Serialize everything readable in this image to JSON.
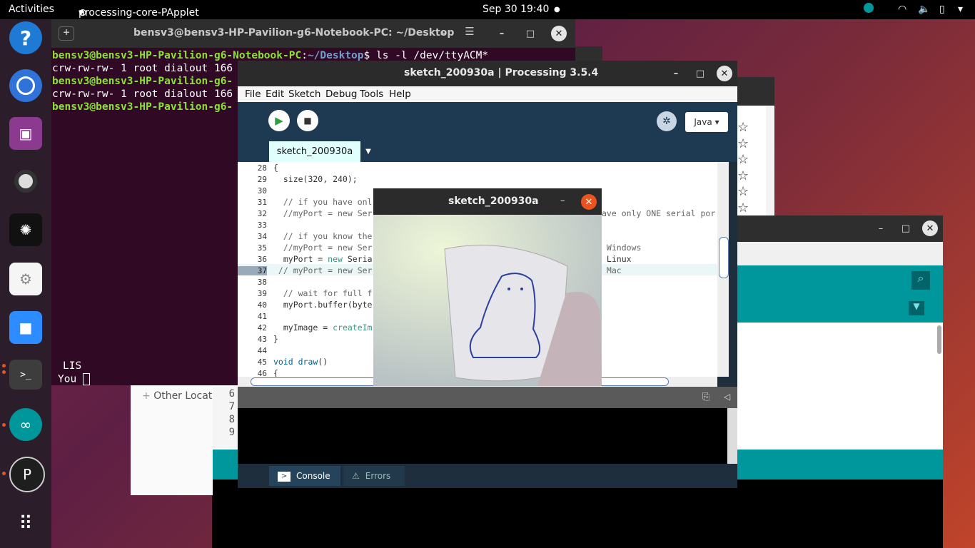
{
  "topbar": {
    "activities": "Activities",
    "app_name": "processing-core-PApplet",
    "clock": "Sep 30  19:40"
  },
  "dock": {
    "items": [
      "help",
      "chromium",
      "video-editor",
      "webcam",
      "iota-wallet",
      "settings",
      "zoom",
      "terminal",
      "arduino",
      "processing",
      "app-grid"
    ]
  },
  "terminal": {
    "title": "bensv3@bensv3-HP-Pavilion-g6-Notebook-PC: ~/Desktop",
    "prompt_user": "bensv3@bensv3-HP-Pavilion-g6-Notebook-PC",
    "prompt_path": "~/Desktop",
    "command": "$ ls -l /dev/ttyACM*",
    "line2": "crw-rw-rw- 1 root dialout 166",
    "line3_user": "bensv3@bensv3-HP-Pavilion-g6-",
    "line4": "crw-rw-rw- 1 root dialout 166",
    "line5_user": "bensv3@bensv3-HP-Pavilion-g6-",
    "bottom_line1": "LIS",
    "bottom_line2": "You"
  },
  "files": {
    "other_locations": "Other Locat"
  },
  "processing": {
    "title": "sketch_200930a | Processing 3.5.4",
    "menu": [
      "File",
      "Edit",
      "Sketch",
      "Debug",
      "Tools",
      "Help"
    ],
    "mode": "Java",
    "tab": "sketch_200930a",
    "line_numbers": [
      "28",
      "29",
      "30",
      "31",
      "32",
      "33",
      "34",
      "35",
      "36",
      "37",
      "38",
      "39",
      "40",
      "41",
      "42",
      "43",
      "44",
      "45",
      "46"
    ],
    "code": {
      "l28": "{",
      "l29": "  size(320, 240);",
      "l31": "  // if you have onl",
      "l32": "  //myPort = new Ser",
      "l32_tail": "ave only ONE serial por",
      "l34": "  // if you know the",
      "l35": "  //myPort = new Ser",
      "l35_tail": " Windows",
      "l36": "  myPort = ",
      "l36_new": "new",
      "l36_b": " Seria",
      "l36_tail": " Linux",
      "l37": " // myPort = new Ser",
      "l37_tail": " Mac",
      "l39": "  // wait for full f",
      "l40": "  myPort.buffer(byte",
      "l42a": "  myImage = ",
      "l42b": "createIm",
      "l43": "}",
      "l45a": "void ",
      "l45b": "draw",
      "l45c": "()",
      "l46": "{"
    },
    "console_lines": [
      "6",
      "7",
      "8",
      "9"
    ],
    "console_tab": "Console",
    "errors_tab": "Errors"
  },
  "sketch_window": {
    "title": "sketch_200930a"
  },
  "colors": {
    "ubuntu_orange": "#e95420",
    "terminal_bg": "#300a24",
    "processing_bg": "#1d3a52",
    "arduino_teal": "#00979c"
  }
}
